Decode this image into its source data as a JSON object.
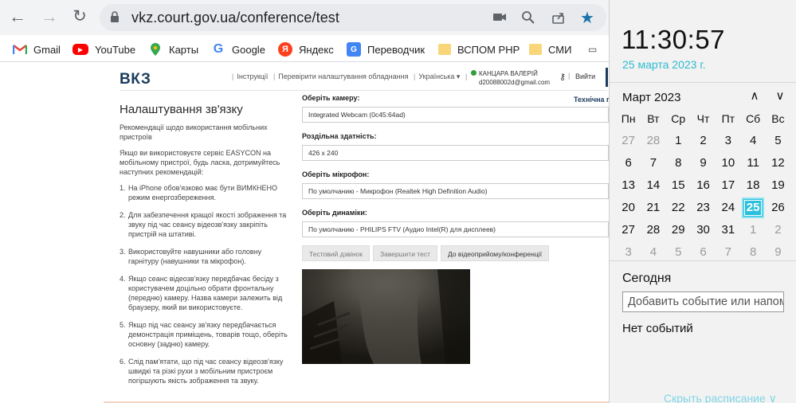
{
  "browser": {
    "url": "vkz.court.gov.ua/conference/test",
    "bookmarks": [
      {
        "label": "Gmail",
        "icon": "gmail-icon"
      },
      {
        "label": "YouTube",
        "icon": "youtube-icon"
      },
      {
        "label": "Карты",
        "icon": "maps-icon"
      },
      {
        "label": "Google",
        "icon": "google-icon"
      },
      {
        "label": "Яндекс",
        "icon": "yandex-icon"
      },
      {
        "label": "Переводчик",
        "icon": "translate-icon"
      },
      {
        "label": "ВСПОМ РНР",
        "icon": "folder-icon"
      },
      {
        "label": "СМИ",
        "icon": "folder-icon"
      }
    ]
  },
  "site": {
    "logo": "ВКЗ",
    "nav": [
      "Інструкції",
      "Перевірити налаштування обладнання",
      "Українська ▾"
    ],
    "user_name": "КАНЦАРА ВАЛЕРІЙ",
    "user_email": "d20088002d@gmail.com",
    "exit": "Вийти",
    "tech": "Технічна п"
  },
  "left": {
    "title": "Налаштування зв'язку",
    "intro": "Рекомендації щодо використання мобільних пристроїв",
    "lead": "Якщо ви використовуєте сервіс EASYCON на мобільному пристрої, будь ласка, дотримуйтесь наступних рекомендацій:",
    "items": [
      "На iPhone обов'язково має бути ВИМКНЕНО режим енергозбереження.",
      "Для забезпечення кращої якості зображення та звуку під час сеансу відеозв'язку закріпіть пристрій на штативі.",
      "Використовуйте навушники або головну гарнітуру (навушники та мікрофон).",
      "Якщо сеанс відеозв'язку передбачає бесіду з користувачем доцільно обрати фронтальну (передню) камеру. Назва камери залежить від браузеру, який ви використовуєте.",
      "Якщо під час сеансу зв'язку передбачається демонстрація приміщень, товарів тощо, оберіть основну (задню) камеру.",
      "Слід пам'ятати, що під час сеансу відеозв'язку швидкі та різкі рухи з мобільним пристроєм погіршують якість зображення та звуку."
    ]
  },
  "form": {
    "camera_label": "Оберіть камеру:",
    "camera_value": "Integrated Webcam (0c45:64ad)",
    "resolution_label": "Роздільна здатність:",
    "resolution_value": "426 x 240",
    "mic_label": "Оберіть мікрофон:",
    "mic_value": "По умолчанию - Микрофон (Realtek High Definition Audio)",
    "speaker_label": "Оберіть динаміки:",
    "speaker_value": "По умолчанию - PHILIPS FTV (Аудио Intel(R) для дисплеев)",
    "btn_test_call": "Тестовий дзвінок",
    "btn_finish": "Завершити тест",
    "btn_conference": "До відеоприйому/конференції"
  },
  "calendar": {
    "time": "11:30:57",
    "date": "25 марта 2023 г.",
    "month": "Март 2023",
    "weekdays": [
      "Пн",
      "Вт",
      "Ср",
      "Чт",
      "Пт",
      "Сб",
      "Вс"
    ],
    "days": [
      "27",
      "28",
      "1",
      "2",
      "3",
      "4",
      "5",
      "6",
      "7",
      "8",
      "9",
      "10",
      "11",
      "12",
      "13",
      "14",
      "15",
      "16",
      "17",
      "18",
      "19",
      "20",
      "21",
      "22",
      "23",
      "24",
      "25",
      "26",
      "27",
      "28",
      "29",
      "30",
      "31",
      "1",
      "2",
      "3",
      "4",
      "5",
      "6",
      "7",
      "8",
      "9"
    ],
    "today_index": 26,
    "muted_indexes": [
      0,
      1,
      33,
      34,
      35,
      36,
      37,
      38,
      39,
      40,
      41
    ],
    "today_label": "Сегодня",
    "event_placeholder": "Добавить событие или напом",
    "no_events": "Нет событий",
    "hide_schedule": "Скрыть расписание ∨",
    "accent": "#2bc0dc"
  }
}
